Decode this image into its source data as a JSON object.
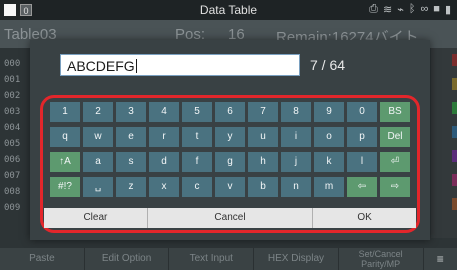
{
  "status_bar": {
    "title": "Data Table",
    "left_icon_2": "0",
    "right_icons": [
      "printer-icon",
      "wifi-icon",
      "usb-icon",
      "bluetooth-icon",
      "link-icon",
      "lock-icon",
      "battery-icon"
    ]
  },
  "table": {
    "header_left": "Table03",
    "pos_label": "Pos:",
    "pos_value": "16",
    "remain_label": "Remain:16274バイト",
    "rows": [
      "000",
      "001",
      "002",
      "003",
      "004",
      "005",
      "006",
      "007",
      "008",
      "009"
    ]
  },
  "dialog": {
    "input_value": "ABCDEFG",
    "counter": "7 / 64",
    "keyboard_rows": [
      [
        "1",
        "2",
        "3",
        "4",
        "5",
        "6",
        "7",
        "8",
        "9",
        "0",
        "BS"
      ],
      [
        "q",
        "w",
        "e",
        "r",
        "t",
        "y",
        "u",
        "i",
        "o",
        "p",
        "Del"
      ],
      [
        "↑A",
        "a",
        "s",
        "d",
        "f",
        "g",
        "h",
        "j",
        "k",
        "l",
        "⏎"
      ],
      [
        "#!?",
        "␣",
        "z",
        "x",
        "c",
        "v",
        "b",
        "n",
        "m",
        "⇦",
        "⇨"
      ]
    ],
    "clear_label": "Clear",
    "cancel_label": "Cancel",
    "ok_label": "OK",
    "colors": {
      "key": "#4a7280",
      "key_special": "#5d9a6f",
      "highlight_frame": "#e3262b"
    }
  },
  "toolbar": {
    "paste": "Paste",
    "edit_option": "Edit Option",
    "text_input": "Text Input",
    "hex_display": "HEX Display",
    "set_cancel": "Set/Cancel",
    "parity_mp": "Parity/MP",
    "menu_icon": "menu-icon"
  }
}
